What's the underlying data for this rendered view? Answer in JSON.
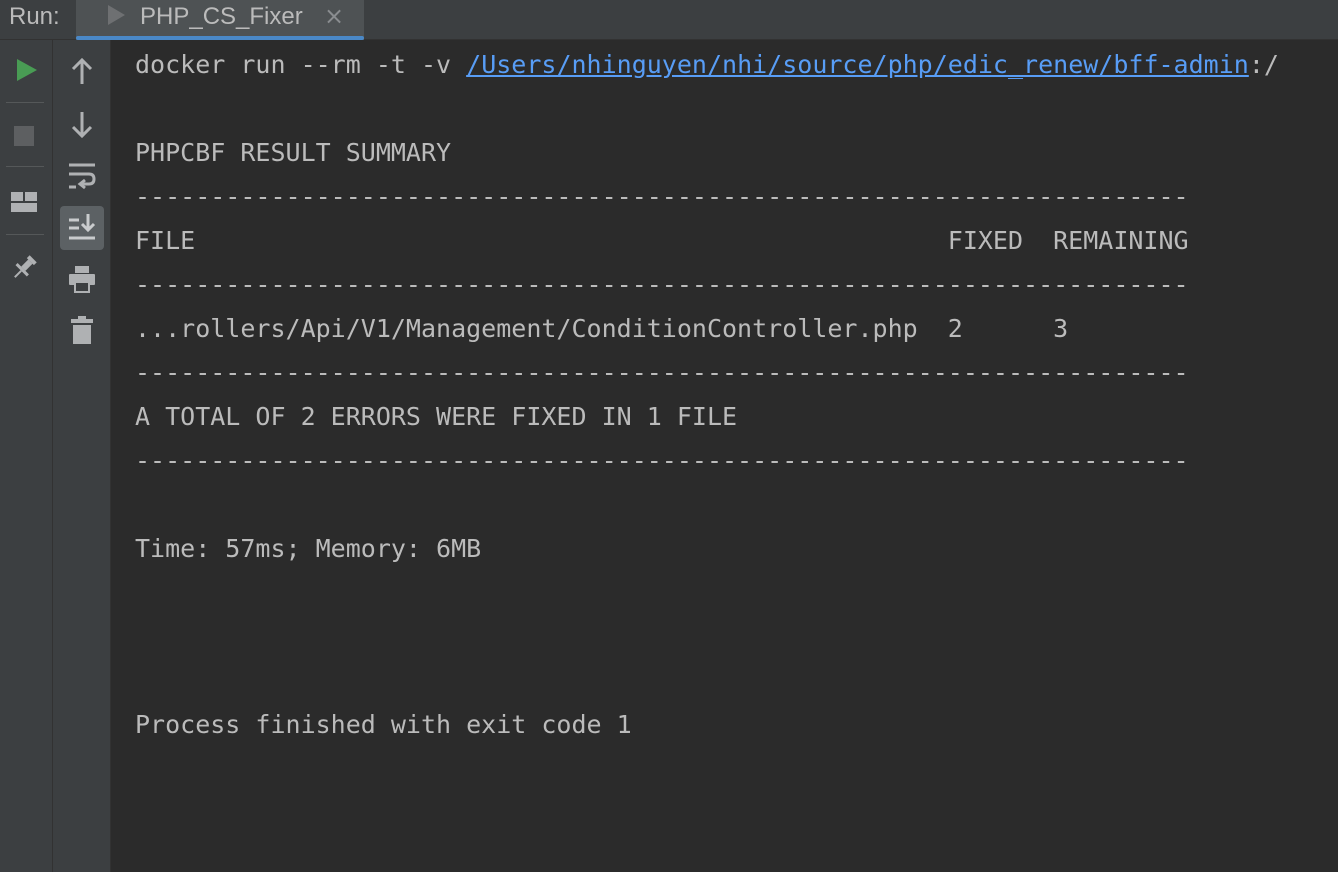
{
  "header": {
    "run_label": "Run:",
    "tab_label": "PHP_CS_Fixer",
    "tab_close": "×"
  },
  "toolbar_left": [
    {
      "name": "rerun-icon",
      "label": "Rerun"
    },
    {
      "name": "stop-icon",
      "label": "Stop"
    },
    {
      "name": "layout-icon",
      "label": "Layout"
    },
    {
      "name": "pin-icon",
      "label": "Pin tab"
    }
  ],
  "toolbar_console": [
    {
      "name": "up-arrow-icon",
      "label": "Previous occurrence"
    },
    {
      "name": "down-arrow-icon",
      "label": "Next occurrence"
    },
    {
      "name": "soft-wrap-icon",
      "label": "Soft-wrap"
    },
    {
      "name": "scroll-to-end-icon",
      "label": "Scroll to the end",
      "active": true
    },
    {
      "name": "print-icon",
      "label": "Print"
    },
    {
      "name": "trash-icon",
      "label": "Clear all"
    }
  ],
  "console": {
    "cmd_prefix": "docker run --rm -t -v ",
    "cmd_link": "/Users/nhinguyen/nhi/source/php/edic_renew/bff-admin",
    "cmd_suffix": ":/",
    "summary_title": "PHPCBF RESULT SUMMARY",
    "divider": "----------------------------------------------------------------------",
    "header_row": "FILE                                                  FIXED  REMAINING",
    "file_row": {
      "file": "...rollers/Api/V1/Management/ConditionController.php",
      "fixed": "2",
      "remaining": "3"
    },
    "total_line": "A TOTAL OF 2 ERRORS WERE FIXED IN 1 FILE",
    "time_line": "Time: 57ms; Memory: 6MB",
    "exit_line": "Process finished with exit code 1"
  },
  "colors": {
    "background": "#2b2b2b",
    "toolbar": "#3c3f41",
    "text": "#bbbbbb",
    "link": "#589df6",
    "run_green": "#499c54",
    "tab_underline": "#4a88c7"
  }
}
